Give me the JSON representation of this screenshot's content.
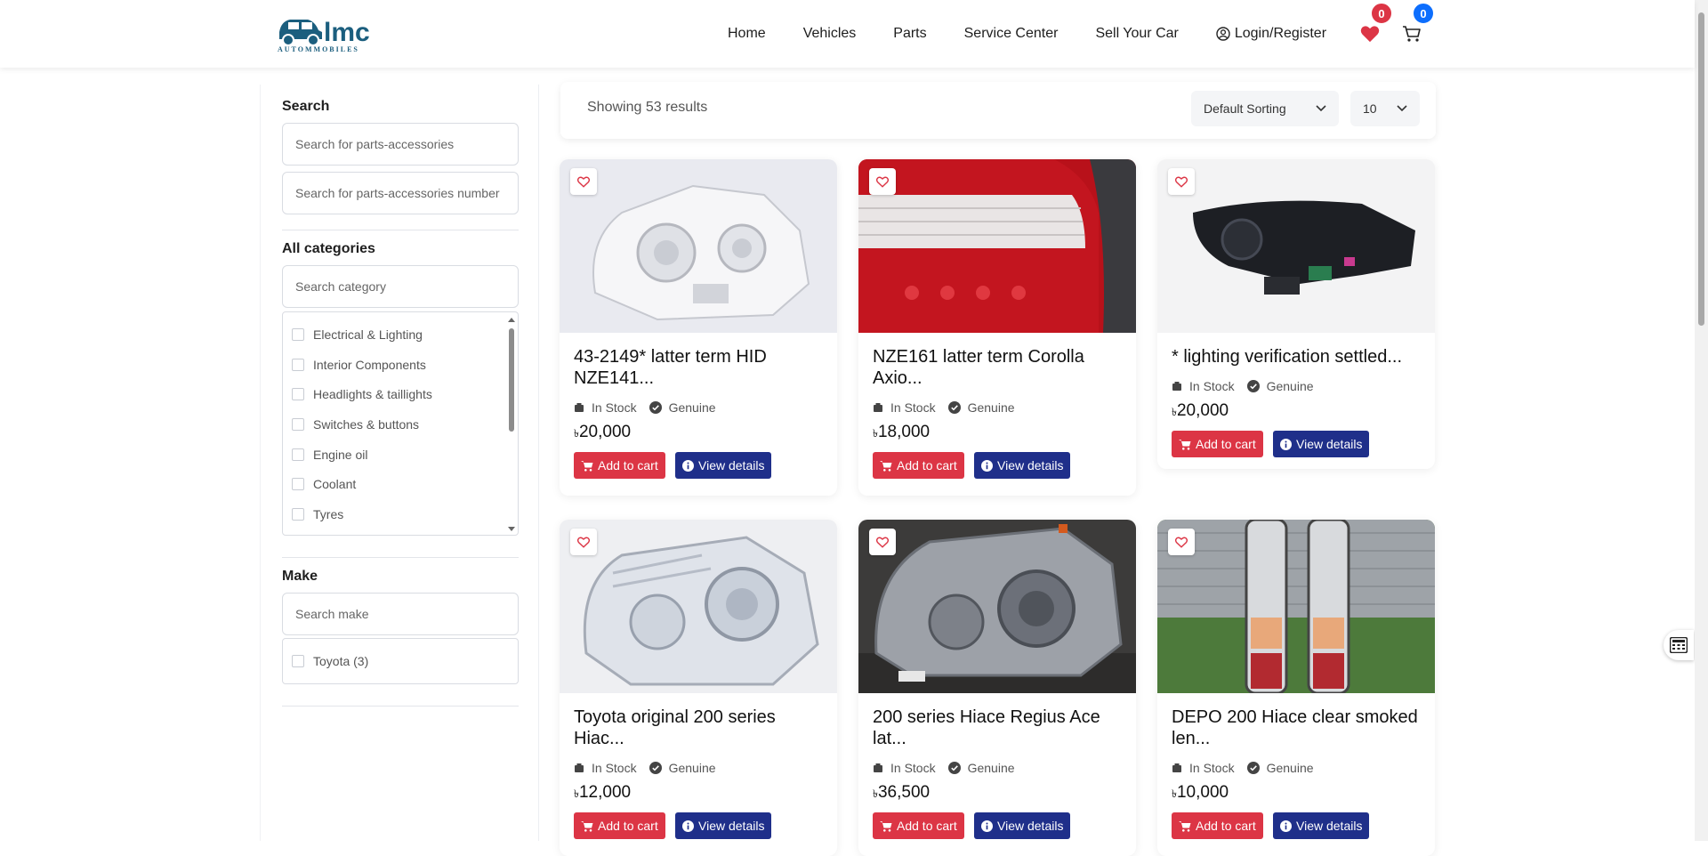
{
  "header": {
    "logo_text": "lmc",
    "logo_sub": "AUTOMMOBILES",
    "nav": [
      "Home",
      "Vehicles",
      "Parts",
      "Service Center",
      "Sell Your Car",
      "Login/Register"
    ],
    "wishlist_count": "0",
    "cart_count": "0"
  },
  "sidebar": {
    "search_title": "Search",
    "search_placeholder": "Search for parts-accessories",
    "number_placeholder": "Search for parts-accessories number",
    "categories_title": "All categories",
    "category_search_placeholder": "Search category",
    "categories": [
      "Electrical & Lighting",
      "Interior Components",
      "Headlights & taillights",
      "Switches & buttons",
      "Engine oil",
      "Coolant",
      "Tyres"
    ],
    "make_title": "Make",
    "make_placeholder": "Search make",
    "makes": [
      "Toyota (3)"
    ]
  },
  "results": {
    "count_text": "Showing 53 results",
    "sort": "Default Sorting",
    "per_page": "10"
  },
  "labels": {
    "in_stock": "In Stock",
    "genuine": "Genuine",
    "add_to_cart": "Add to cart",
    "view_details": "View details",
    "currency": "৳"
  },
  "products": [
    {
      "title": "43-2149* latter term HID NZE141...",
      "price": "20,000"
    },
    {
      "title": "NZE161 latter term Corolla Axio...",
      "price": "18,000"
    },
    {
      "title": "* lighting verification settled...",
      "price": "20,000"
    },
    {
      "title": "Toyota original 200 series Hiac...",
      "price": "12,000"
    },
    {
      "title": "200 series Hiace Regius Ace lat...",
      "price": "36,500"
    },
    {
      "title": "DEPO 200 Hiace clear smoked len...",
      "price": "10,000"
    }
  ],
  "colors": {
    "accent_red": "#dc3545",
    "accent_blue": "#1f2f8a",
    "badge_red": "#dc3545",
    "badge_blue": "#0d6efd",
    "logo_blue": "#1b5e7e"
  }
}
